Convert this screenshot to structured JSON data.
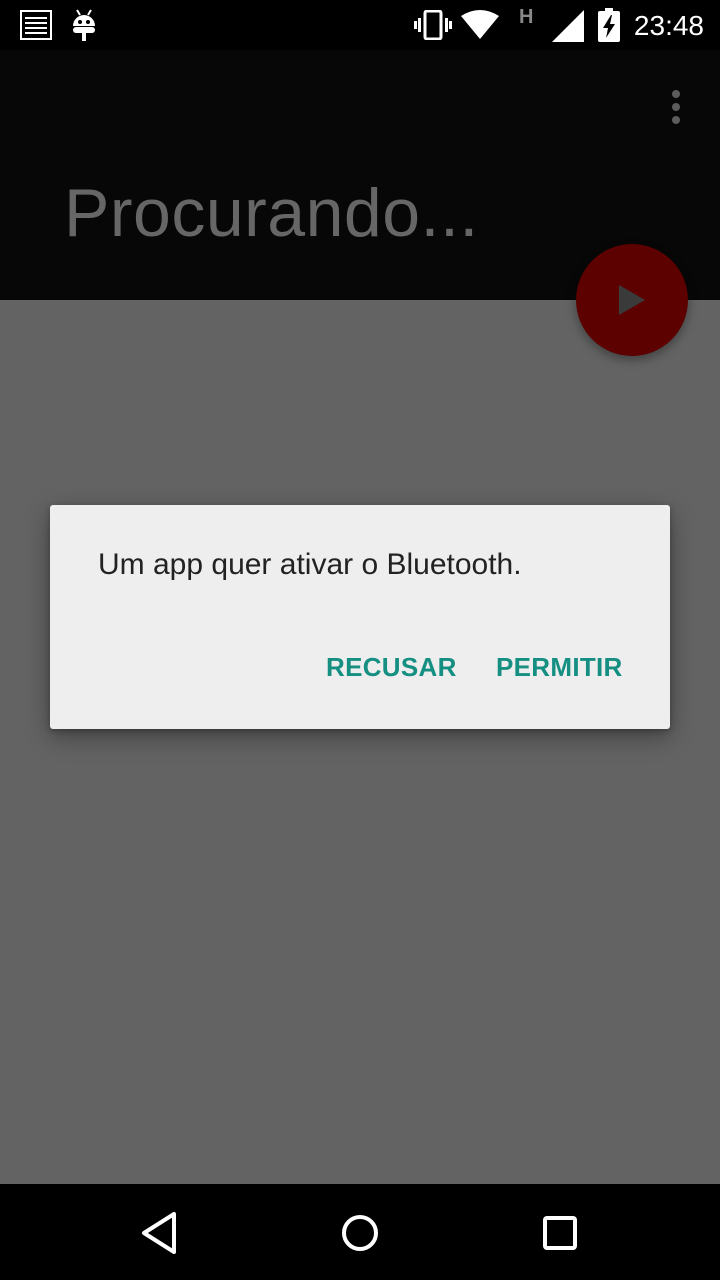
{
  "status_bar": {
    "time": "23:48",
    "network_type": "H",
    "icons": [
      "notification-icon",
      "android-debug-icon",
      "vibrate-icon",
      "wifi-icon",
      "cell-signal-icon",
      "battery-charging-icon"
    ]
  },
  "app_bar": {
    "title": "Procurando...",
    "overflow_icon": "more-vert-icon"
  },
  "fab": {
    "icon": "play-icon"
  },
  "dialog": {
    "message": "Um app quer ativar o Bluetooth.",
    "decline_label": "RECUSAR",
    "allow_label": "PERMITIR",
    "button_color": "#158f82"
  },
  "nav_bar": {
    "icons": [
      "back-icon",
      "home-icon",
      "recents-icon"
    ]
  },
  "colors": {
    "scrim_background": "#636363",
    "app_bar": "#070707",
    "fab": "#5c0000",
    "dialog": "#eeeeee"
  }
}
